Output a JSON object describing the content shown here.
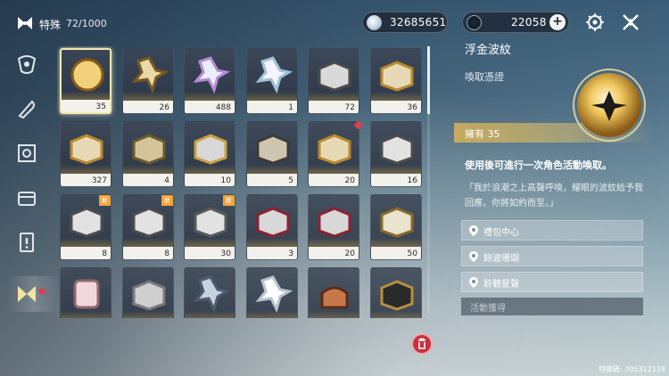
{
  "header": {
    "category_title": "特殊",
    "category_count": "72/1000",
    "currency_primary": "32685651",
    "currency_secondary": "22058",
    "plus_symbol": "+"
  },
  "nav": {
    "items": [
      "dragon-emblem",
      "feather-quill",
      "portrait-frame",
      "chest-box",
      "exclamation-card",
      "butterfly-special"
    ],
    "active_index": 5
  },
  "grid": {
    "items": [
      {
        "name": "golden-orb",
        "qty": "35",
        "new": false,
        "selected": true
      },
      {
        "name": "golden-dagger",
        "qty": "26",
        "new": false
      },
      {
        "name": "rainbow-coral",
        "qty": "488",
        "new": false
      },
      {
        "name": "rainbow-coral-small",
        "qty": "1",
        "new": false
      },
      {
        "name": "locked-chest",
        "qty": "72",
        "new": false
      },
      {
        "name": "gold-chest",
        "qty": "36",
        "new": false
      },
      {
        "name": "gold-chest",
        "qty": "327",
        "new": false
      },
      {
        "name": "ornate-chest",
        "qty": "4",
        "new": false
      },
      {
        "name": "cabinet-chest",
        "qty": "10",
        "new": false
      },
      {
        "name": "lantern-chest",
        "qty": "5",
        "new": false
      },
      {
        "name": "gold-chest",
        "qty": "20",
        "new": false,
        "reddot": true
      },
      {
        "name": "silver-chest-emblem",
        "qty": "16",
        "new": false
      },
      {
        "name": "silver-chest-emblem",
        "qty": "8",
        "new": true
      },
      {
        "name": "silver-chest-emblem",
        "qty": "8",
        "new": true
      },
      {
        "name": "silver-chest",
        "qty": "30",
        "new": true
      },
      {
        "name": "red-chest",
        "qty": "3",
        "new": false
      },
      {
        "name": "red-chest",
        "qty": "20",
        "new": false
      },
      {
        "name": "gold-silver-chest",
        "qty": "50",
        "new": false
      },
      {
        "name": "jar",
        "qty": "",
        "new": false
      },
      {
        "name": "scroll-ring",
        "qty": "",
        "new": false
      },
      {
        "name": "feather-blade",
        "qty": "",
        "new": false
      },
      {
        "name": "paper-crane",
        "qty": "",
        "new": false
      },
      {
        "name": "cake",
        "qty": "",
        "new": false
      },
      {
        "name": "black-card",
        "qty": "",
        "new": false
      }
    ],
    "new_badge": "新"
  },
  "detail": {
    "title": "浮金波紋",
    "type": "喚取憑證",
    "owned": "擁有 35",
    "description": "使用後可進行一次角色活動喚取。",
    "quote": "「我於浪潮之上高聲呼喚，耀眼的波紋給予我回應，你將如約而至。」",
    "sources": [
      "禮包中心",
      "餘波珊瑚",
      "聆聽星聲"
    ],
    "source_header": "活動獲得"
  },
  "footer": {
    "id_text": "特徵碼: 705312118"
  },
  "colors": {
    "accent_gold": "#d8b45a",
    "alert_red": "#e5394f",
    "new_badge": "#f3a53a"
  }
}
